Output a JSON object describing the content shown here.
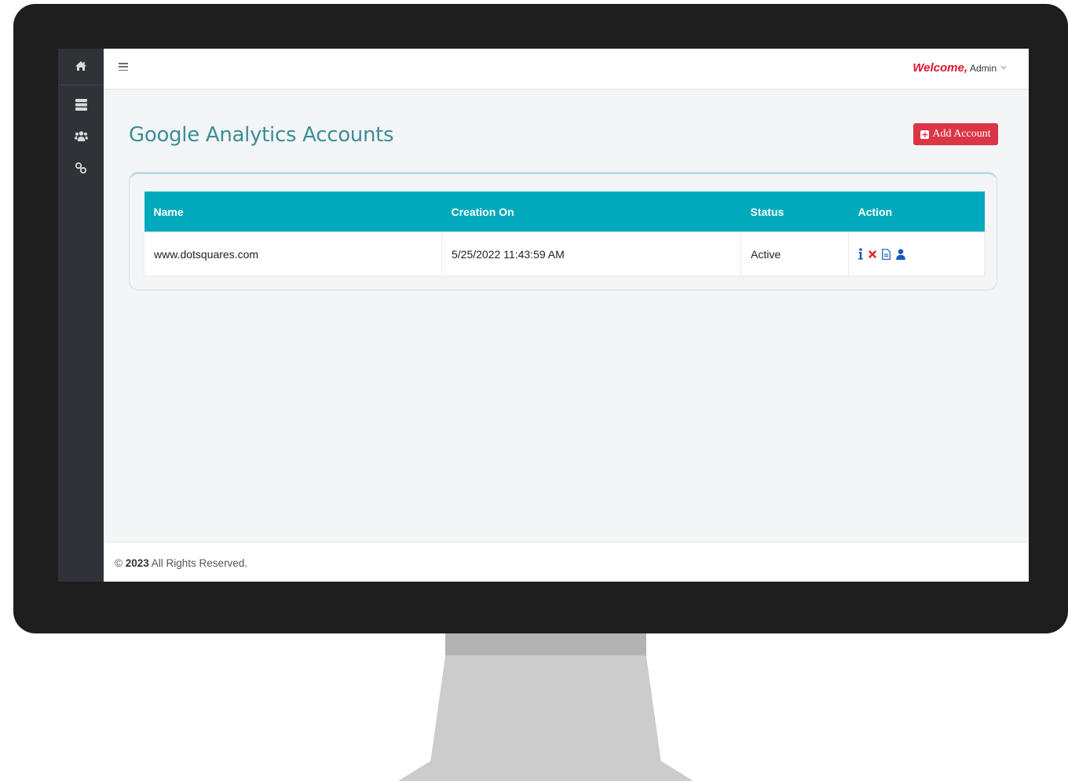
{
  "header": {
    "welcome": "Welcome,",
    "user": "Admin"
  },
  "page": {
    "title": "Google Analytics Accounts",
    "add_button": "Add Account"
  },
  "table": {
    "columns": [
      "Name",
      "Creation On",
      "Status",
      "Action"
    ],
    "rows": [
      {
        "name": "www.dotsquares.com",
        "created": "5/25/2022 11:43:59 AM",
        "status": "Active"
      }
    ]
  },
  "sidebar": {
    "items": [
      "home-icon",
      "server-icon",
      "users-icon",
      "link-icon"
    ]
  },
  "footer": {
    "copyright": "©",
    "year": "2023",
    "text": "All Rights Reserved."
  },
  "colors": {
    "accent": "#00a9bb",
    "title": "#3a8f95",
    "danger": "#dc3545",
    "welcome": "#e0162b",
    "sidebar": "#2f3338"
  }
}
